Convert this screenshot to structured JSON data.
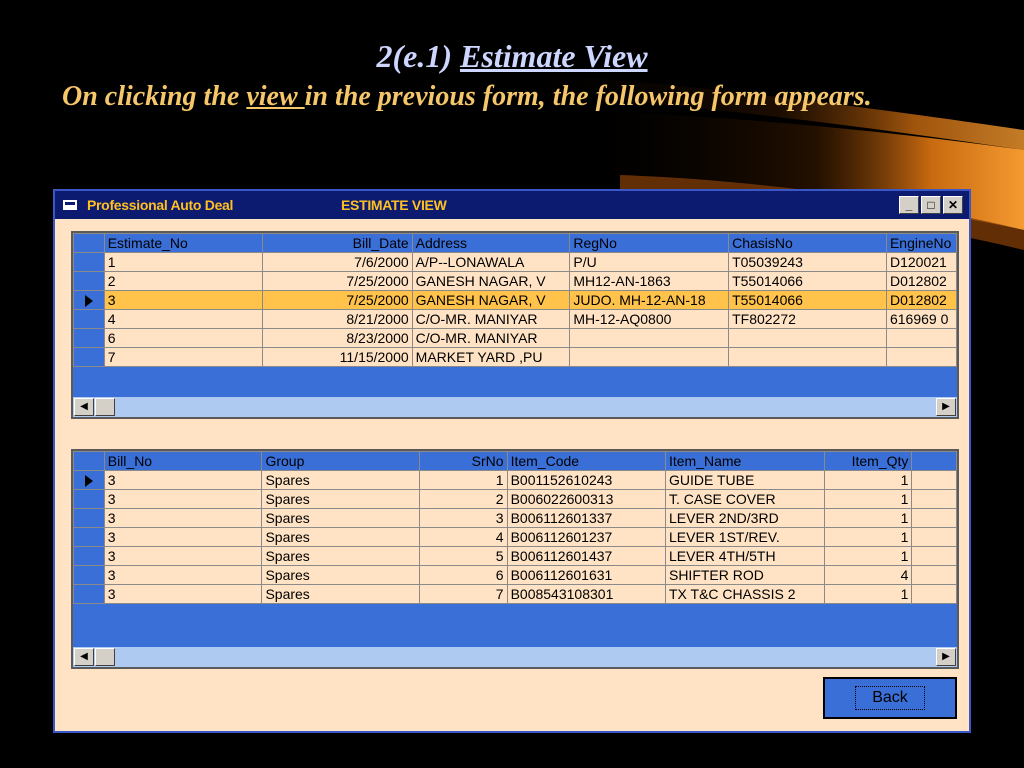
{
  "slide": {
    "title_prefix": "2(e.1) ",
    "title_link": "Estimate View",
    "text_before": "On clicking the ",
    "text_link": "view ",
    "text_after": "in the previous form, the following form appears."
  },
  "window": {
    "app_name": "Professional Auto Deal",
    "title": "ESTIMATE VIEW",
    "controls": {
      "minimize": "_",
      "maximize": "□",
      "close": "✕"
    }
  },
  "estimates_grid": {
    "columns": [
      "Estimate_No",
      "Bill_Date",
      "Address",
      "RegNo",
      "ChasisNo",
      "EngineNo"
    ],
    "rows": [
      [
        "1",
        "7/6/2000",
        "A/P--LONAWALA",
        "P/U",
        "T05039243",
        "D120021"
      ],
      [
        "2",
        "7/25/2000",
        "GANESH NAGAR, V",
        "MH12-AN-1863",
        "T55014066",
        "D012802"
      ],
      [
        "3",
        "7/25/2000",
        "GANESH NAGAR, V",
        "JUDO. MH-12-AN-18",
        "T55014066",
        "D012802"
      ],
      [
        "4",
        "8/21/2000",
        "C/O-MR. MANIYAR",
        "MH-12-AQ0800",
        "TF802272",
        "616969 0"
      ],
      [
        "6",
        "8/23/2000",
        "C/O-MR. MANIYAR",
        "",
        "",
        ""
      ],
      [
        "7",
        "11/15/2000",
        "MARKET YARD ,PU",
        "",
        "",
        ""
      ]
    ],
    "selected_row": 2
  },
  "items_grid": {
    "columns": [
      "Bill_No",
      "Group",
      "SrNo",
      "Item_Code",
      "Item_Name",
      "Item_Qty"
    ],
    "rows": [
      [
        "3",
        "Spares",
        "1",
        "B001152610243",
        "GUIDE TUBE",
        "1"
      ],
      [
        "3",
        "Spares",
        "2",
        "B006022600313",
        "T. CASE COVER",
        "1"
      ],
      [
        "3",
        "Spares",
        "3",
        "B006112601337",
        "LEVER 2ND/3RD",
        "1"
      ],
      [
        "3",
        "Spares",
        "4",
        "B006112601237",
        "LEVER 1ST/REV.",
        "1"
      ],
      [
        "3",
        "Spares",
        "5",
        "B006112601437",
        "LEVER 4TH/5TH",
        "1"
      ],
      [
        "3",
        "Spares",
        "6",
        "B006112601631",
        "SHIFTER ROD",
        "4"
      ],
      [
        "3",
        "Spares",
        "7",
        "B008543108301",
        "TX T&C CHASSIS 2",
        "1"
      ]
    ],
    "current_row": 0
  },
  "scroll": {
    "left_arrow": "◀",
    "right_arrow": "▶"
  },
  "buttons": {
    "back": "Back"
  },
  "colors": {
    "background": "#000000",
    "window_bg": "#ffe3c4",
    "grid_blue": "#3a6fd8",
    "highlight": "#ffc24a",
    "titlebar": "#0c1b70",
    "title_text": "#ffc020"
  }
}
